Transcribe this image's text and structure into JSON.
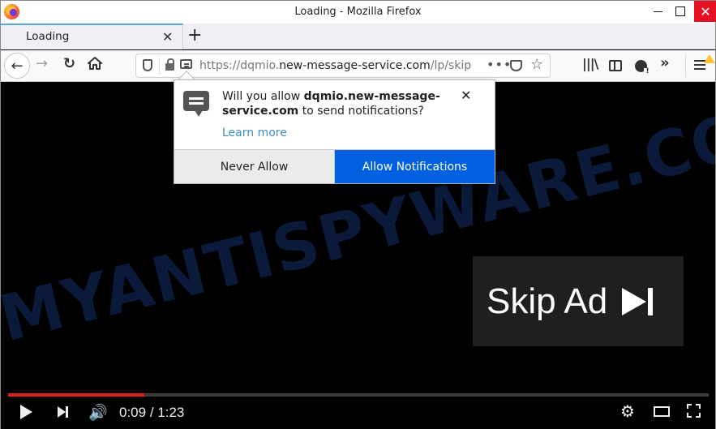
{
  "window": {
    "title": "Loading - Mozilla Firefox",
    "minimize_icon": "minimize-icon",
    "maximize_icon": "maximize-icon",
    "close_glyph": "✕"
  },
  "tabs": [
    {
      "label": "Loading",
      "close_glyph": "✕",
      "active": true
    }
  ],
  "new_tab_glyph": "+",
  "nav": {
    "back_glyph": "←",
    "forward_glyph": "→",
    "reload_glyph": "↻",
    "url": {
      "scheme": "https://",
      "subdomain": "dqmio.",
      "host": "new-message-service.com",
      "path": "/lp/skip",
      "full": "https://dqmio.new-message-service.com/lp/skip"
    },
    "page_actions_glyph": "•••",
    "bookmark_glyph": "☆",
    "overflow_glyph": "»"
  },
  "permission_popup": {
    "message_prefix": "Will you allow ",
    "site": "dqmio.new-message-service.com",
    "message_suffix": " to send notifications?",
    "learn_more": "Learn more",
    "close_glyph": "✕",
    "never_allow": "Never Allow",
    "allow": "Allow Notifications",
    "allow_color": "#0060df"
  },
  "watermark": "MYANTISPYWARE.COM",
  "video": {
    "skip_ad_label": "Skip Ad",
    "current_time": "0:09",
    "duration": "1:23",
    "time_display": "0:09 / 1:23",
    "progress_fraction": 0.195,
    "progress_color": "#e0201e",
    "volume_glyph": "🔊",
    "settings_glyph": "⚙"
  }
}
